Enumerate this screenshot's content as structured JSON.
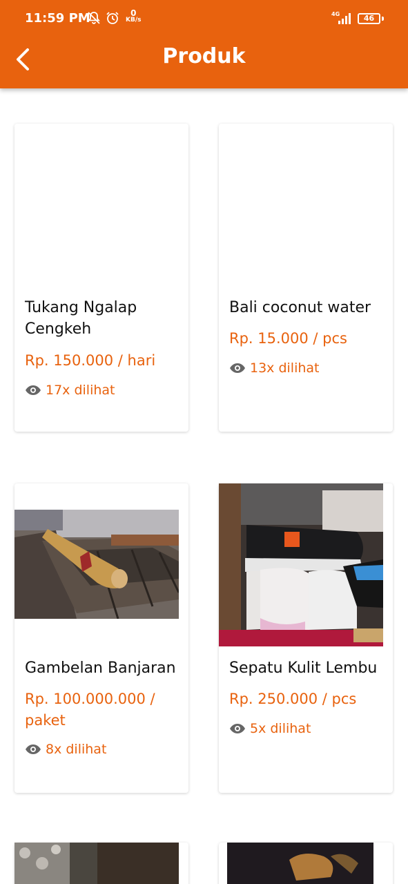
{
  "status_bar": {
    "time": "11:59 PM",
    "data_speed_value": "0",
    "data_speed_unit": "KB/s",
    "network": "4G",
    "battery": "46"
  },
  "header": {
    "title": "Produk",
    "back_icon": "back-arrow-icon"
  },
  "colors": {
    "primary": "#E8620E",
    "text": "#111111",
    "card_bg": "#FFFFFF"
  },
  "products": [
    {
      "name": "Tukang Ngalap Cengkeh",
      "price": "Rp. 150.000 / hari",
      "views": "17x dilihat"
    },
    {
      "name": "Bali coconut water",
      "price": "Rp. 15.000 / pcs",
      "views": "13x dilihat"
    },
    {
      "name": "Gambelan Banjaran",
      "price": "Rp. 100.000.000 / paket",
      "views": "8x dilihat"
    },
    {
      "name": "Sepatu Kulit Lembu",
      "price": "Rp. 250.000 / pcs",
      "views": "5x dilihat"
    }
  ]
}
